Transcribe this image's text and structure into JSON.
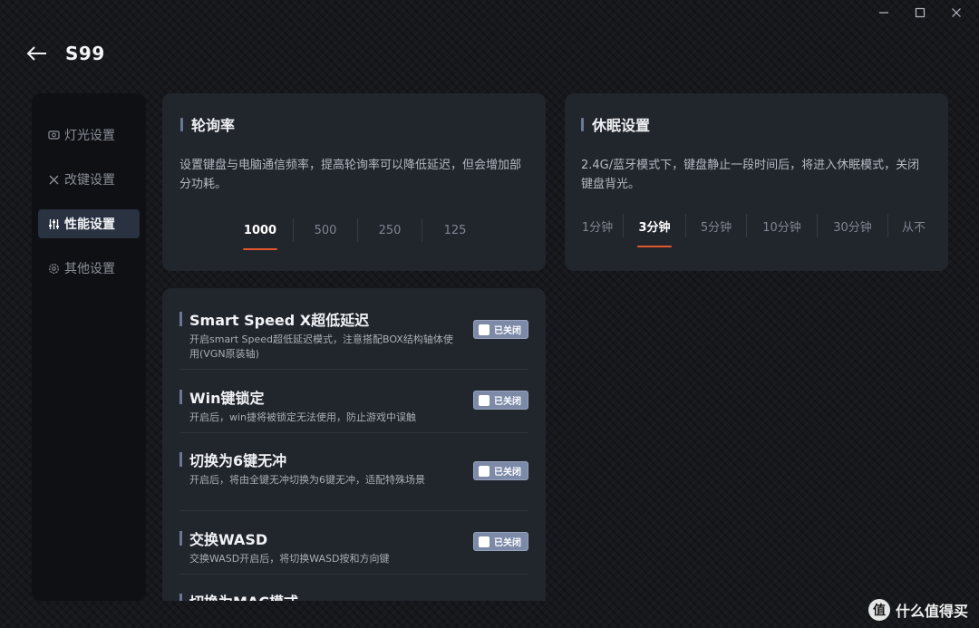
{
  "window": {
    "minimize": "—",
    "maximize": "☐",
    "close": "✕"
  },
  "header": {
    "title": "S99"
  },
  "sidebar": {
    "items": [
      {
        "label": "灯光设置"
      },
      {
        "label": "改键设置"
      },
      {
        "label": "性能设置"
      },
      {
        "label": "其他设置"
      }
    ]
  },
  "polling": {
    "title": "轮询率",
    "description": "设置键盘与电脑通信频率，提高轮询率可以降低延迟，但会增加部分功耗。",
    "options": [
      "1000",
      "500",
      "250",
      "125"
    ],
    "selected": "1000"
  },
  "sleep": {
    "title": "休眠设置",
    "description": "2.4G/蓝牙模式下，键盘静止一段时间后，将进入休眠模式，关闭键盘背光。",
    "options": [
      "1分钟",
      "3分钟",
      "5分钟",
      "10分钟",
      "30分钟",
      "从不"
    ],
    "selected": "3分钟"
  },
  "performance": {
    "items": [
      {
        "title": "Smart Speed X超低延迟",
        "description": "开启smart Speed超低延迟模式，注意搭配BOX结构轴体使用(VGN原装轴)",
        "toggle": "已关闭"
      },
      {
        "title": "Win键锁定",
        "description": "开启后，win捷将被锁定无法使用，防止游戏中误触",
        "toggle": "已关闭"
      },
      {
        "title": "切换为6键无冲",
        "description": "开启后，将由全键无冲切换为6键无冲，适配特殊场景",
        "toggle": "已关闭"
      },
      {
        "title": "交换WASD",
        "description": "交换WASD开启后，将切换WASD按和方向键",
        "toggle": "已关闭"
      },
      {
        "title": "切换为MAC模式"
      }
    ]
  },
  "watermark": {
    "logo": "值",
    "text": "什么值得买"
  },
  "colors": {
    "accent": "#e4572e",
    "toggle": "#7c8aa8",
    "card": "#21252c",
    "sidebar": "#0e1013"
  }
}
